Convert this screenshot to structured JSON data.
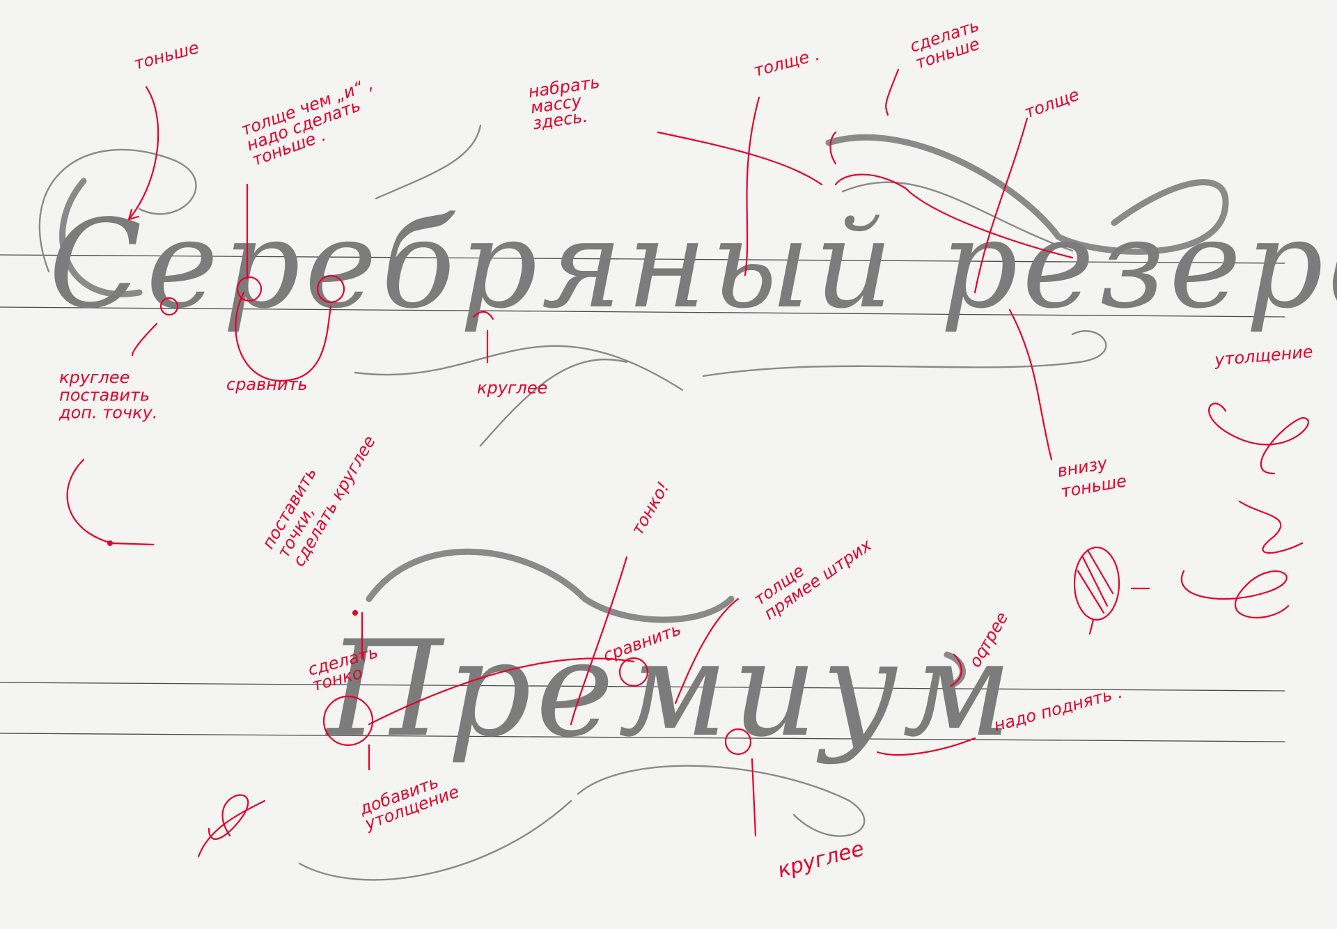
{
  "script_words": {
    "top": "Серебряный резерв",
    "bottom": "Премиум"
  },
  "annotations": {
    "thinner_top_left": "тоньше",
    "thicker_than_i": "толще чем „и“ ,\nнадо сделать\nтоньше .",
    "gain_mass": "набрать\nмассу\nздесь.",
    "thicker_1": "толще .",
    "make_thinner": "сделать\nтоньше",
    "thicker_2": "толще",
    "rounder_add_dot": "круглее\nпоставить\nдоп. точку.",
    "compare_1": "сравнить",
    "rounder_1": "круглее",
    "thickening": "утолщение",
    "bottom_thinner": "внизу\nтоньше",
    "place_dots": "поставить\nточки,\nсделать круглее",
    "thin": "тонко!",
    "thicker_straighter": "толще\nпрямее штрих",
    "compare_2": "сравнить",
    "sharper": "острее",
    "make_thin": "сделать\nтонко",
    "add_thickening": "добавить\nутолщение",
    "must_raise": "надо поднять .",
    "rounder_2": "круглее"
  },
  "colors": {
    "paper": "#f4f4f2",
    "ink_gray": "#8a8a8a",
    "annotation_red": "#e8002a",
    "guide_line": "#4a4a4a"
  }
}
